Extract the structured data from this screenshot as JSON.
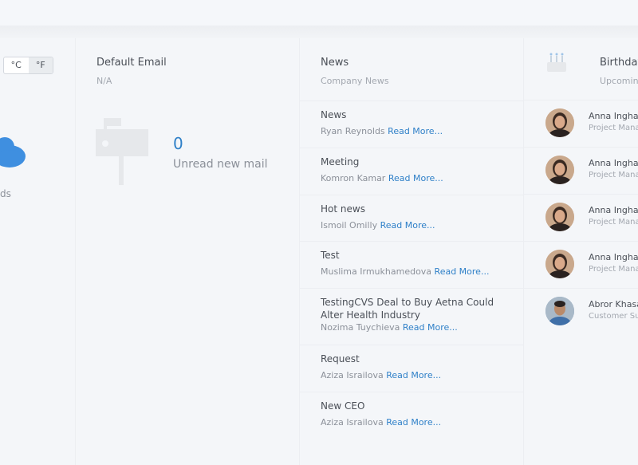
{
  "weather": {
    "unit_c": "°C",
    "unit_f": "°F",
    "description_fragment": "ds",
    "icon": "cloud-icon",
    "accent": "#2f80c8"
  },
  "email": {
    "title": "Default Email",
    "subtitle": "N/A",
    "count": "0",
    "label": "Unread new mail",
    "icon": "mailbox-icon"
  },
  "news": {
    "title": "News",
    "subtitle": "Company News",
    "read_more": "Read More...",
    "items": [
      {
        "title": "News",
        "author": "Ryan Reynolds"
      },
      {
        "title": "Meeting",
        "author": "Komron Kamar"
      },
      {
        "title": "Hot news",
        "author": "Ismoil Omilly"
      },
      {
        "title": "Test",
        "author": "Muslima Irmukhamedova"
      },
      {
        "title": "TestingCVS Deal to Buy Aetna Could Alter Health Industry",
        "author": "Nozima Tuychieva"
      },
      {
        "title": "Request",
        "author": "Aziza Israilova"
      },
      {
        "title": "New CEO",
        "author": "Aziza Israilova"
      }
    ]
  },
  "birthdays": {
    "title": "Birthday",
    "subtitle": "Upcomin",
    "icon": "cake-icon",
    "people": [
      {
        "name": "Anna Ingha",
        "role": "Project Mana"
      },
      {
        "name": "Anna Ingha",
        "role": "Project Mana"
      },
      {
        "name": "Anna Ingha",
        "role": "Project Mana"
      },
      {
        "name": "Anna Ingha",
        "role": "Project Mana"
      },
      {
        "name": "Abror Khasa",
        "role": "Customer Su"
      }
    ]
  }
}
